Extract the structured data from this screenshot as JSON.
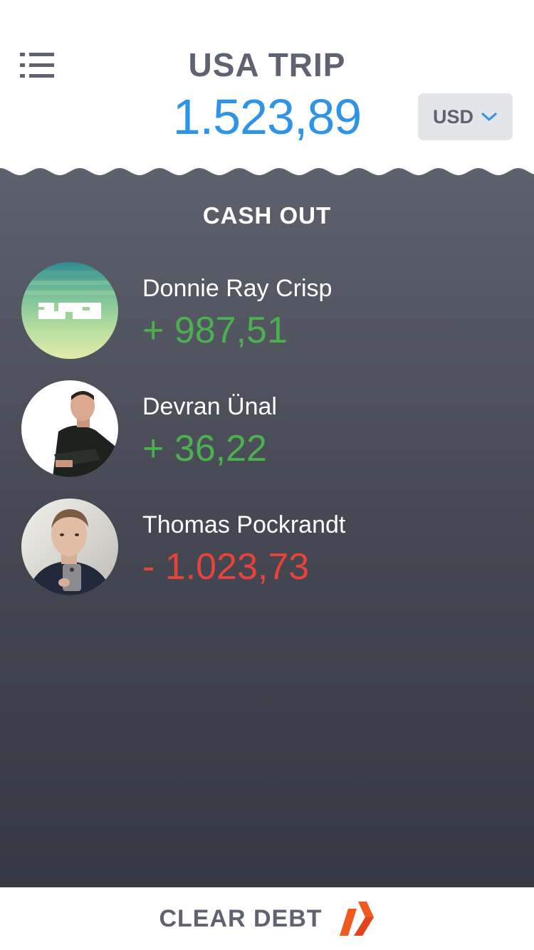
{
  "header": {
    "title": "USA TRIP",
    "total": "1.523,89",
    "currency": "USD",
    "menu_icon": "list-menu-icon",
    "currency_icon": "chevron-down-icon"
  },
  "panel": {
    "title": "CASH OUT",
    "people": [
      {
        "name": "Donnie Ray Crisp",
        "amount": "+ 987,51",
        "status": "positive"
      },
      {
        "name": "Devran Ünal",
        "amount": "+ 36,22",
        "status": "positive"
      },
      {
        "name": "Thomas Pockrandt",
        "amount": "- 1.023,73",
        "status": "negative"
      }
    ]
  },
  "footer": {
    "label": "CLEAR DEBT",
    "logo_icon": "double-slash-logo-icon"
  },
  "colors": {
    "accent_blue": "#2f93e6",
    "positive_green": "#4caf50",
    "negative_red": "#e8423b",
    "logo_orange": "#f05a1e",
    "text_gray": "#5f6371"
  }
}
